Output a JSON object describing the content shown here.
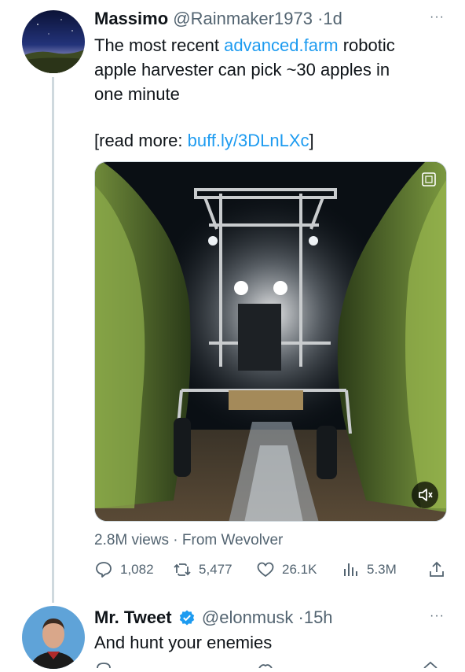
{
  "tweet1": {
    "display_name": "Massimo",
    "handle": "@Rainmaker1973",
    "separator": "·",
    "time": "1d",
    "text_line_1_a": "The most recent ",
    "text_link": "advanced.farm",
    "text_line_1_b": " robotic",
    "text_line_2": "apple harvester can pick ~30 apples in",
    "text_line_3": "one minute",
    "read_more_a": "[read more: ",
    "read_more_link": "buff.ly/3DLnLXc",
    "read_more_b": "]",
    "views_text": "2.8M views · From Wevolver",
    "replies": "1,082",
    "retweets": "5,477",
    "likes": "26.1K",
    "view_count": "5.3M",
    "media_icons": [
      "gif-icon",
      "sound-off-icon"
    ]
  },
  "tweet2": {
    "display_name": "Mr. Tweet",
    "handle": "@elonmusk",
    "separator": "·",
    "time": "15h",
    "text": "And hunt your enemies"
  },
  "more_label": "···",
  "colors": {
    "link": "#1d9bf0",
    "muted": "#536471",
    "text": "#0f1419",
    "verified": "#1d9bf0"
  }
}
